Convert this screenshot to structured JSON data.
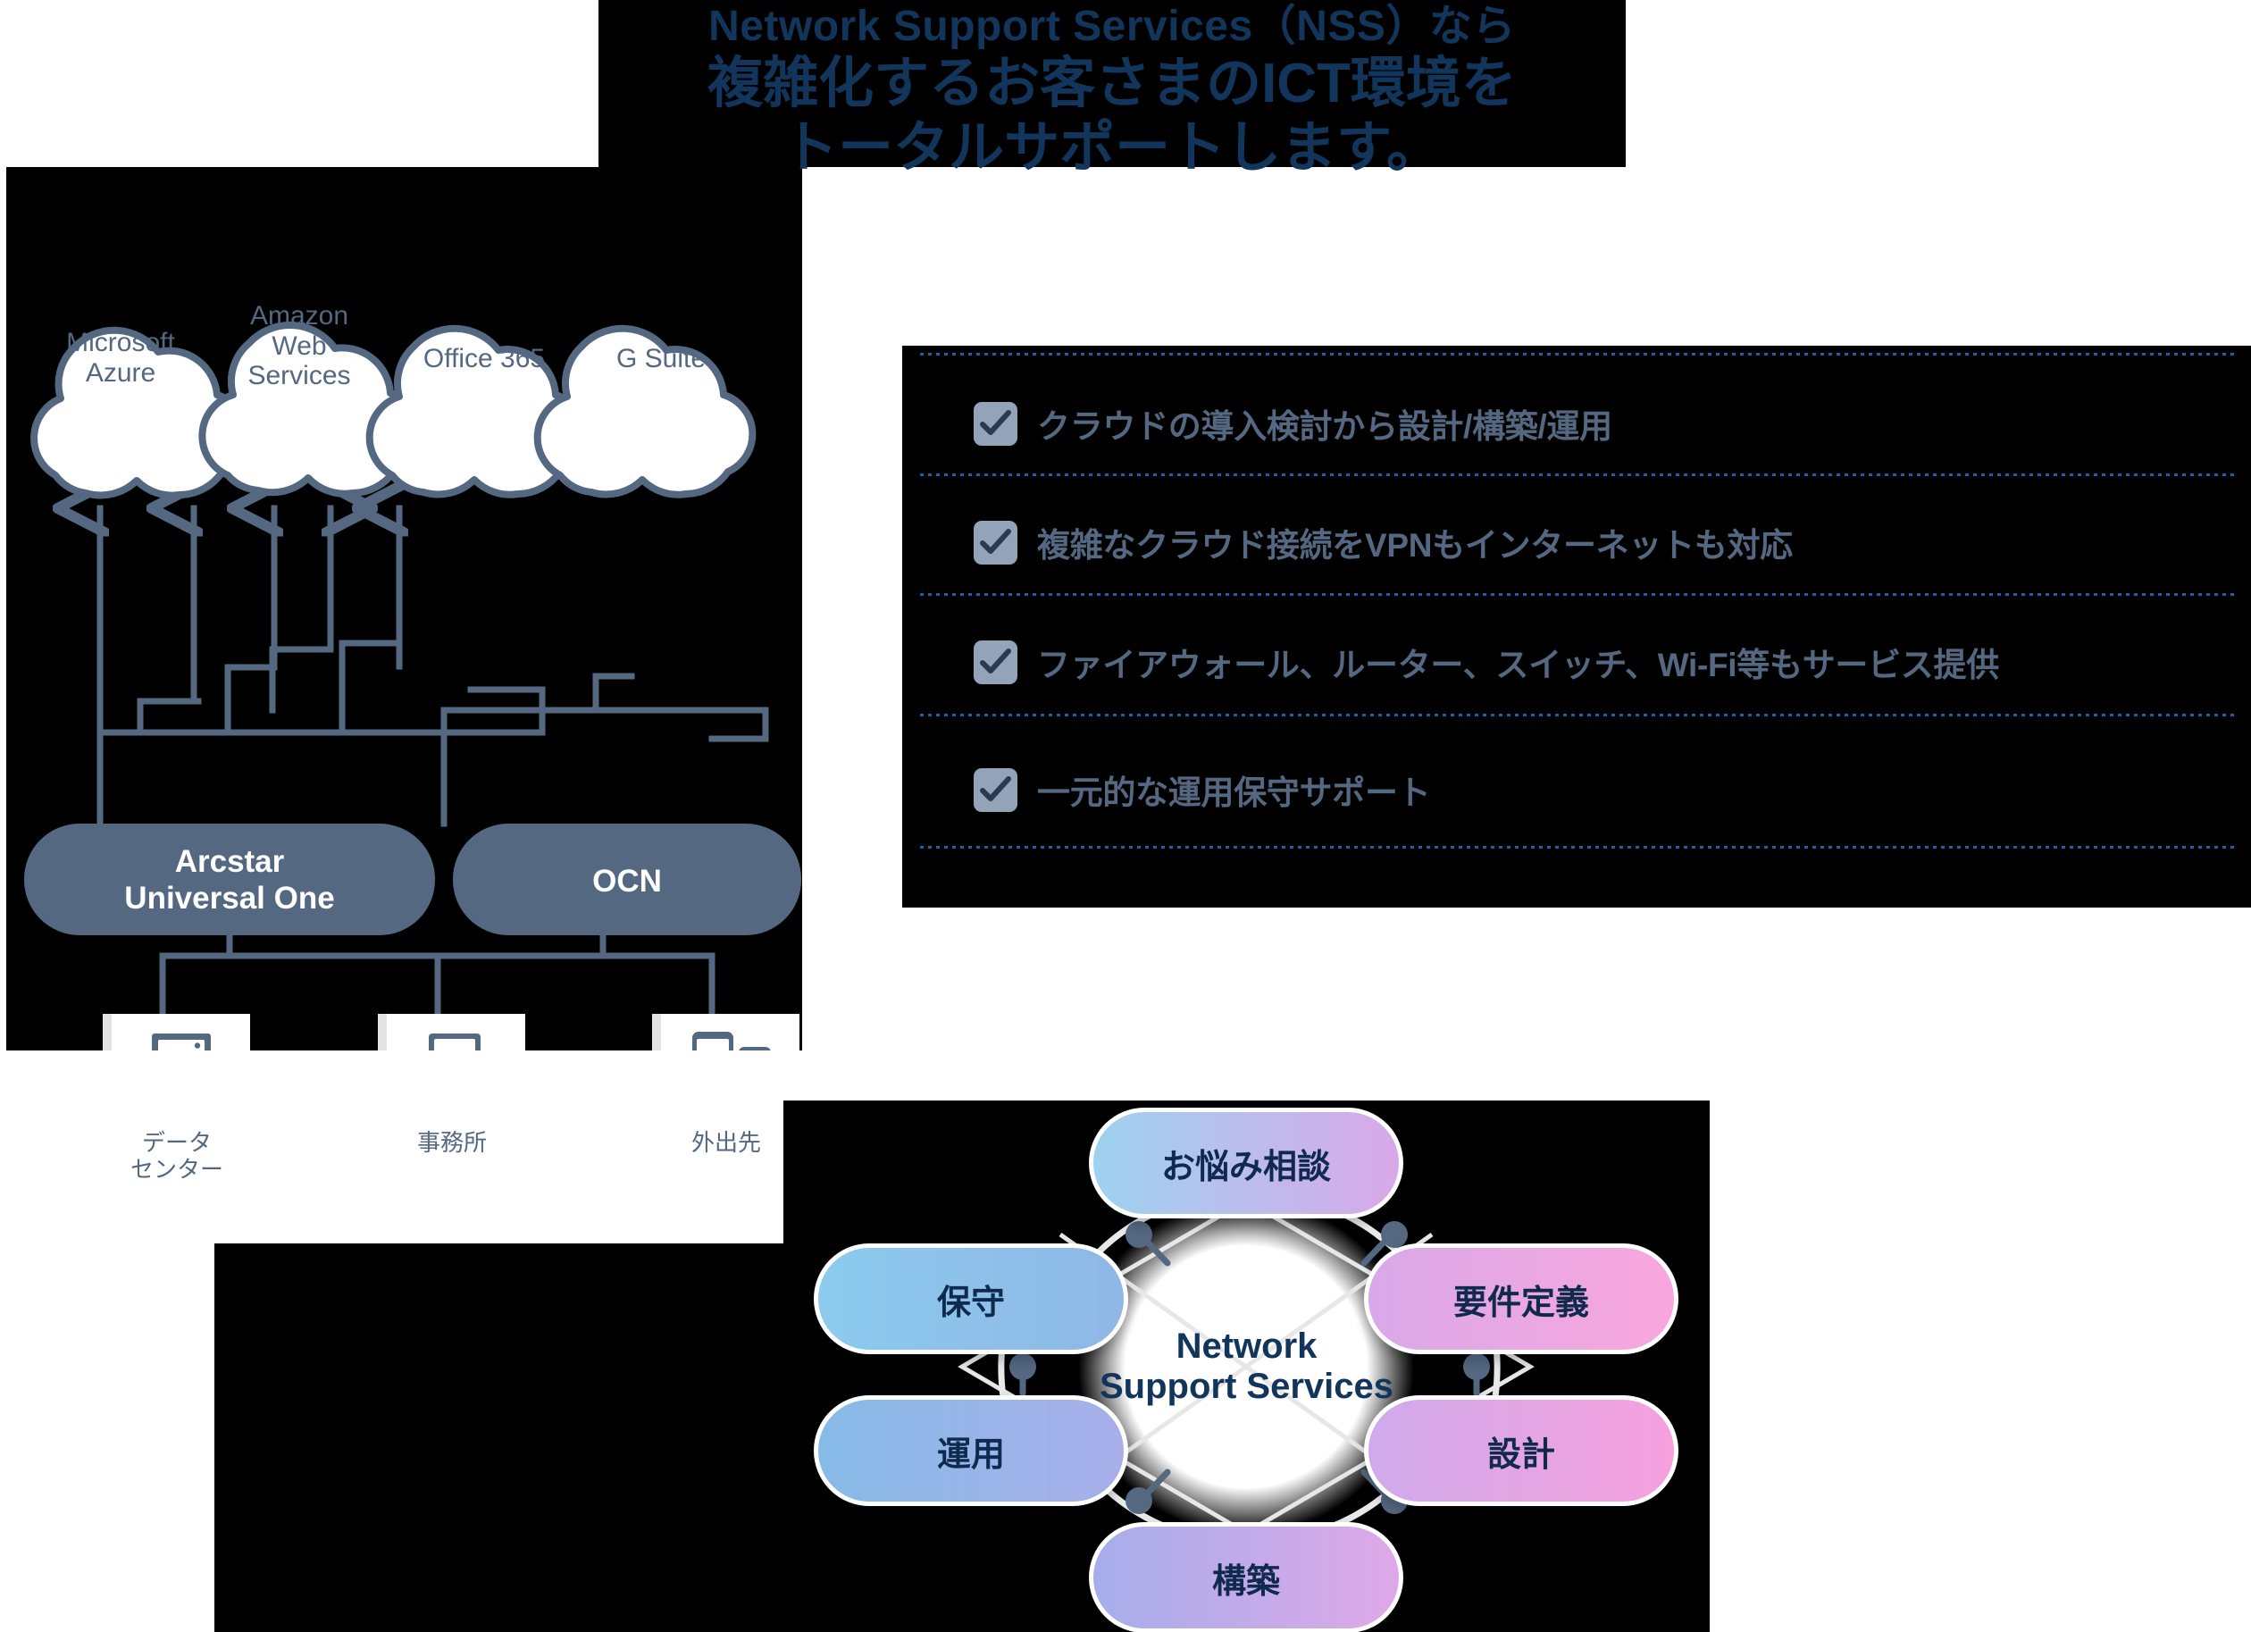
{
  "header": {
    "line1": "Network Support Services（NSS）なら",
    "line2": "複雑化するお客さまのICT環境を",
    "line3": "トータルサポートします。"
  },
  "colors": {
    "brand_navy": "#12355b",
    "slate_blue": "#546881",
    "checkbox": "#93a3b8",
    "divider_blue": "#1b5fa6",
    "panel_black": "#000000",
    "white": "#ffffff"
  },
  "network_diagram": {
    "clouds": [
      {
        "label": "Microsoft\nAzure",
        "icon": "cloud-icon"
      },
      {
        "label": "Amazon\nWeb\nServices",
        "icon": "cloud-icon"
      },
      {
        "label": "Office 365",
        "icon": "cloud-icon"
      },
      {
        "label": "G Suite",
        "icon": "cloud-icon"
      }
    ],
    "networks": [
      {
        "label": "Arcstar\nUniversal One"
      },
      {
        "label": "OCN"
      }
    ],
    "devices": [
      {
        "caption": "データ\nセンター",
        "icon": "server-rack-icon"
      },
      {
        "caption": "事務所",
        "icon": "laptop-icon"
      },
      {
        "caption": "外出先",
        "icon": "mobile-devices-icon"
      }
    ]
  },
  "checklist": {
    "items": [
      {
        "icon": "checkbox-checked-icon",
        "text": "クラウドの導入検討から設計/構築/運用"
      },
      {
        "icon": "checkbox-checked-icon",
        "text": "複雑なクラウド接続をVPNもインターネットも対応"
      },
      {
        "icon": "checkbox-checked-icon",
        "text": "ファイアウォール、ルーター、スイッチ、Wi-Fi等もサービス提供"
      },
      {
        "icon": "checkbox-checked-icon",
        "text": "一元的な運用保守サポート"
      }
    ]
  },
  "cycle_diagram": {
    "center": "Network\nSupport Services",
    "steps": [
      {
        "label": "お悩み相談",
        "position": "top",
        "gradient_from": "#9dd2f0",
        "gradient_to": "#d9a8e8"
      },
      {
        "label": "要件定義",
        "position": "right-upper",
        "gradient_from": "#d9a8e8",
        "gradient_to": "#f9a7dd"
      },
      {
        "label": "設計",
        "position": "right-lower",
        "gradient_from": "#cfaaea",
        "gradient_to": "#f7a0de"
      },
      {
        "label": "構築",
        "position": "bottom",
        "gradient_from": "#a5aeea",
        "gradient_to": "#dfa8e8"
      },
      {
        "label": "運用",
        "position": "left-lower",
        "gradient_from": "#86bbe8",
        "gradient_to": "#a8aeea"
      },
      {
        "label": "保守",
        "position": "left-upper",
        "gradient_from": "#8ccbee",
        "gradient_to": "#8fb7e6"
      }
    ]
  }
}
